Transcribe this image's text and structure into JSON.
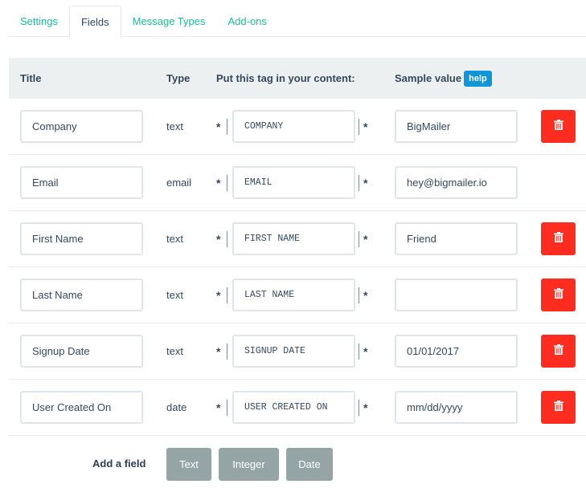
{
  "tabs": [
    {
      "label": "Settings",
      "active": false
    },
    {
      "label": "Fields",
      "active": true
    },
    {
      "label": "Message Types",
      "active": false
    },
    {
      "label": "Add-ons",
      "active": false
    }
  ],
  "table": {
    "headers": {
      "title": "Title",
      "type": "Type",
      "tag": "Put this tag in your content:",
      "sample": "Sample value",
      "help": "help"
    },
    "tag_prefix": "*",
    "tag_suffix": "*",
    "rows": [
      {
        "title": "Company",
        "type": "text",
        "tag": "COMPANY",
        "sample": "BigMailer",
        "deletable": true
      },
      {
        "title": "Email",
        "type": "email",
        "tag": "EMAIL",
        "sample": "hey@bigmailer.io",
        "deletable": false
      },
      {
        "title": "First Name",
        "type": "text",
        "tag": "FIRST NAME",
        "sample": "Friend",
        "deletable": true
      },
      {
        "title": "Last Name",
        "type": "text",
        "tag": "LAST NAME",
        "sample": "",
        "deletable": true
      },
      {
        "title": "Signup Date",
        "type": "text",
        "tag": "SIGNUP DATE",
        "sample": "01/01/2017",
        "deletable": true
      },
      {
        "title": "User Created On",
        "type": "date",
        "tag": "USER CREATED ON",
        "sample": "mm/dd/yyyy",
        "deletable": true
      }
    ]
  },
  "footer": {
    "add_label": "Add a field",
    "buttons": [
      "Text",
      "Integer",
      "Date"
    ]
  },
  "colors": {
    "accent": "#1abc9c",
    "help_badge": "#0e96d6",
    "delete": "#ff2d20",
    "add_button": "#95a5a6",
    "header_bg": "#ecf0f1"
  }
}
